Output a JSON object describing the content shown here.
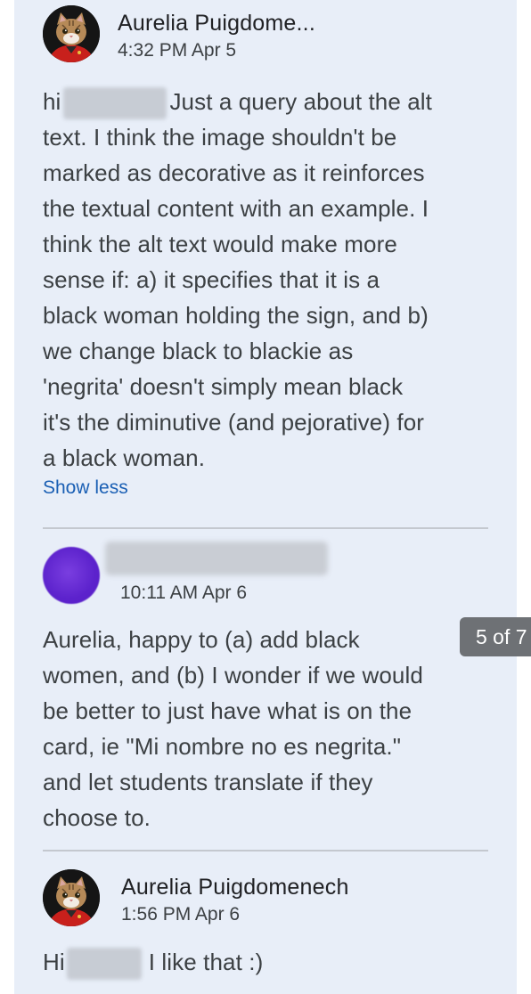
{
  "comments": [
    {
      "author": "Aurelia Puigdome...",
      "time": "4:32 PM Apr 5",
      "lines": [
        {
          "before": "hi",
          "after": "Just a query about the alt"
        },
        "text. I think the image shouldn't be",
        "marked as decorative as it reinforces",
        "the textual content with an example. I",
        "think the alt text would make more",
        "sense if: a) it specifies that it is a",
        "black woman holding the sign, and b)",
        "we change black to blackie as",
        "'negrita' doesn't simply mean black",
        "it's the diminutive (and pejorative) for",
        "a black woman."
      ],
      "toggle_label": "Show less"
    },
    {
      "author": "",
      "time": "10:11 AM Apr 6",
      "lines": [
        "Aurelia, happy to (a) add black",
        "women, and (b) I wonder if we would",
        "be better to just have what is on the",
        "card, ie \"Mi nombre no es negrita.\"",
        "and let students translate if they",
        "choose to."
      ]
    },
    {
      "author": "Aurelia Puigdomenech",
      "time": "1:56 PM Apr 6",
      "lines": [
        {
          "before": "Hi",
          "after": "I like that :)"
        }
      ]
    }
  ],
  "pager": {
    "label": "5 of 7"
  },
  "colors": {
    "panel_background": "#e8eef8",
    "link": "#1a5fb4",
    "avatar_purple": "#5c22cc"
  }
}
